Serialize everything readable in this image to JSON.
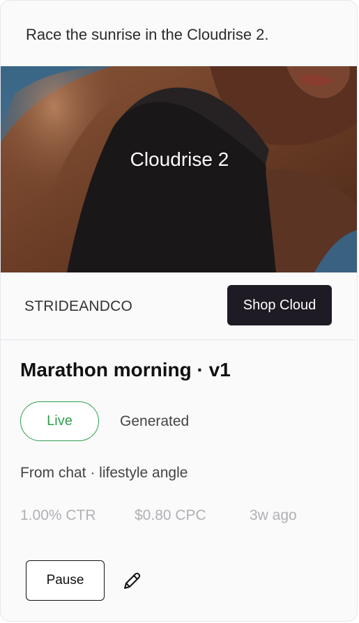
{
  "ad": {
    "primary_text": "Race the sunrise in the Cloudrise 2.",
    "headline": "Cloudrise 2",
    "brand": "STRIDEANDCO",
    "cta_label": "Shop Cloud"
  },
  "variant": {
    "title": "Marathon morning · v1",
    "status": "Live",
    "status_color": "#2f9e4f",
    "source_type": "Generated",
    "origin": "From chat · lifestyle angle",
    "metrics": {
      "ctr": "1.00% CTR",
      "cpc": "$0.80 CPC",
      "age": "3w ago"
    },
    "pause_label": "Pause",
    "edit_icon": "pencil-icon"
  },
  "colors": {
    "cta_bg": "#1e1b24",
    "sky": "#3f6784",
    "muted_text": "#b0b0b6"
  }
}
